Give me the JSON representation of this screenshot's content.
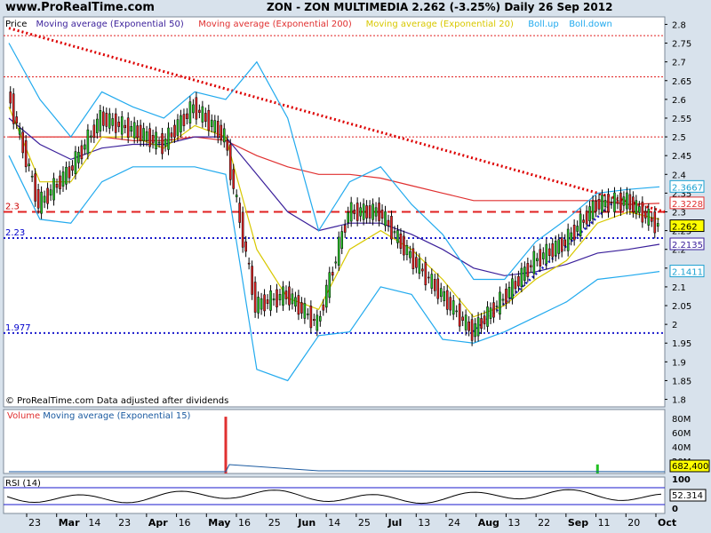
{
  "header": {
    "site": "www.ProRealTime.com",
    "title": "ZON - ZON MULTIMEDIA    2.262 (-3.25%)    Daily  26 Sep 2012"
  },
  "price_panel": {
    "legend": [
      {
        "text": "Price",
        "color": "#000000"
      },
      {
        "text": "Moving average (Exponential 50)",
        "color": "#3a1f9a"
      },
      {
        "text": "Moving average (Exponential 200)",
        "color": "#e03030"
      },
      {
        "text": "Moving average (Exponential 20)",
        "color": "#d8c800"
      },
      {
        "text": "Boll.up",
        "color": "#22aaee"
      },
      {
        "text": "Boll.down",
        "color": "#22aaee"
      }
    ],
    "footer": "© ProRealTime.com  Data adjusted after dividends",
    "tag_labels": [
      {
        "text": "2.3",
        "color": "#cc0000"
      },
      {
        "text": "2.23",
        "color": "#0000cc"
      },
      {
        "text": "1.977",
        "color": "#0000cc"
      }
    ],
    "value_boxes": [
      {
        "text": "2.3667",
        "color": "#1aa0d0"
      },
      {
        "text": "2.3228",
        "color": "#e03030"
      },
      {
        "text": "2.262",
        "color": "#000000",
        "bg": "#ffff00"
      },
      {
        "text": "2.2135",
        "color": "#3a1f9a"
      },
      {
        "text": "2.1411",
        "color": "#1aa0d0"
      }
    ]
  },
  "volume_panel": {
    "legend": [
      {
        "text": "Volume",
        "color": "#e03030"
      },
      {
        "text": "Moving average (Exponential 15)",
        "color": "#1a5aa0"
      }
    ],
    "y_ticks": [
      "80M",
      "60M",
      "40M",
      "20M"
    ],
    "value_box": "682,400"
  },
  "rsi_panel": {
    "legend": "RSI (14)",
    "y_ticks": [
      "100",
      "0"
    ],
    "value_box": "52.314"
  },
  "chart_data": {
    "type": "line",
    "subtype": "candlestick",
    "x_labels": [
      "23",
      "Mar",
      "14",
      "23",
      "Apr",
      "16",
      "May",
      "16",
      "25",
      "Jun",
      "14",
      "25",
      "Jul",
      "13",
      "24",
      "Aug",
      "13",
      "22",
      "Sep",
      "11",
      "20",
      "Oct"
    ],
    "y_ticks": [
      2.8,
      2.75,
      2.7,
      2.65,
      2.6,
      2.55,
      2.5,
      2.45,
      2.4,
      2.35,
      2.3,
      2.25,
      2.2,
      2.15,
      2.1,
      2.05,
      2.0,
      1.95,
      1.9,
      1.85,
      1.8
    ],
    "ylim": [
      1.78,
      2.82
    ],
    "dates": [
      "Feb 23",
      "Mar",
      "Mar 14",
      "Mar 23",
      "Apr",
      "Apr 16",
      "May",
      "May 16",
      "May 25",
      "Jun",
      "Jun 14",
      "Jun 25",
      "Jul",
      "Jul 13",
      "Jul 24",
      "Aug",
      "Aug 13",
      "Aug 22",
      "Sep",
      "Sep 11",
      "Sep 20",
      "Sep 26"
    ],
    "close": [
      2.62,
      2.32,
      2.41,
      2.55,
      2.52,
      2.48,
      2.58,
      2.5,
      2.05,
      2.08,
      2.0,
      2.3,
      2.3,
      2.18,
      2.08,
      1.98,
      2.07,
      2.17,
      2.22,
      2.32,
      2.33,
      2.262
    ],
    "series": [
      {
        "name": "Moving average (Exponential 200)",
        "values": [
          2.5,
          2.5,
          2.5,
          2.5,
          2.49,
          2.49,
          2.5,
          2.49,
          2.45,
          2.42,
          2.4,
          2.4,
          2.39,
          2.37,
          2.35,
          2.33,
          2.33,
          2.33,
          2.33,
          2.33,
          2.32,
          2.3228
        ]
      },
      {
        "name": "Moving average (Exponential 50)",
        "values": [
          2.55,
          2.48,
          2.44,
          2.47,
          2.48,
          2.48,
          2.5,
          2.5,
          2.4,
          2.3,
          2.25,
          2.27,
          2.27,
          2.24,
          2.2,
          2.15,
          2.13,
          2.14,
          2.16,
          2.19,
          2.2,
          2.2135
        ]
      },
      {
        "name": "Moving average (Exponential 20)",
        "values": [
          2.58,
          2.38,
          2.38,
          2.5,
          2.5,
          2.47,
          2.53,
          2.5,
          2.2,
          2.07,
          2.04,
          2.2,
          2.25,
          2.2,
          2.12,
          2.02,
          2.05,
          2.12,
          2.17,
          2.27,
          2.3,
          2.28
        ]
      },
      {
        "name": "Boll.up",
        "values": [
          2.75,
          2.6,
          2.5,
          2.62,
          2.58,
          2.55,
          2.62,
          2.6,
          2.7,
          2.55,
          2.25,
          2.38,
          2.42,
          2.32,
          2.24,
          2.12,
          2.12,
          2.22,
          2.28,
          2.35,
          2.36,
          2.3667
        ]
      },
      {
        "name": "Boll.down",
        "values": [
          2.45,
          2.28,
          2.27,
          2.38,
          2.42,
          2.42,
          2.42,
          2.4,
          1.88,
          1.85,
          1.97,
          1.98,
          2.1,
          2.08,
          1.96,
          1.95,
          1.98,
          2.02,
          2.06,
          2.12,
          2.13,
          2.1411
        ]
      }
    ],
    "horizontal_lines": [
      2.77,
      2.66,
      2.5,
      2.3,
      2.23,
      1.977
    ],
    "volume_spikes_M": [
      {
        "date": "May 16",
        "value": 94
      },
      {
        "date": "Sep 11",
        "value": 15
      }
    ],
    "rsi_last": 52.314,
    "grid": false
  }
}
